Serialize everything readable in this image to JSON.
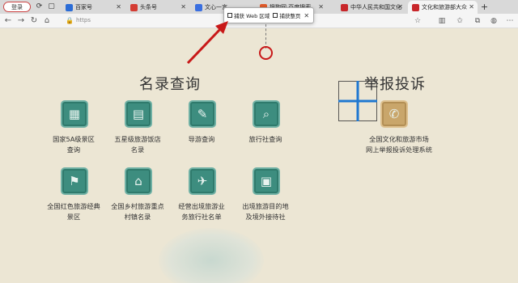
{
  "browser": {
    "login_label": "登录",
    "tabs": [
      {
        "label": "百家号",
        "fav": "#2b6cd6"
      },
      {
        "label": "头条号",
        "fav": "#d43c33"
      },
      {
        "label": "文心一言",
        "fav": "#3a6fe0"
      },
      {
        "label": "搜狗网 百度搜索",
        "fav": "#e05b2b"
      },
      {
        "label": "中华人民共和国文化",
        "fav": "#c8262a"
      },
      {
        "label": "文化和旅游部大众",
        "fav": "#c8262a"
      }
    ],
    "url": "https"
  },
  "capture": {
    "web_area": "捕获 Web 区域",
    "full_page": "捕获整页"
  },
  "sections": {
    "left_title": "名录查询",
    "right_title": "举报投诉"
  },
  "items": [
    {
      "l1": "国家5A级景区",
      "l2": "查询",
      "icon": "scenic-area-icon"
    },
    {
      "l1": "五星级旅游饭店",
      "l2": "名录",
      "icon": "hotel-icon"
    },
    {
      "l1": "导游查询",
      "l2": "",
      "icon": "tour-guide-icon"
    },
    {
      "l1": "旅行社查询",
      "l2": "",
      "icon": "travel-agency-icon"
    },
    {
      "l1": "全国红色旅游经典",
      "l2": "景区",
      "icon": "red-flag-icon"
    },
    {
      "l1": "全国乡村旅游重点",
      "l2": "村镇名录",
      "icon": "village-icon"
    },
    {
      "l1": "经营出境旅游业",
      "l2": "务旅行社名单",
      "icon": "airplane-icon"
    },
    {
      "l1": "出境旅游目的地",
      "l2": "及境外接待社",
      "icon": "destination-icon"
    }
  ],
  "report": {
    "l1": "全国文化和旅游市场",
    "l2": "网上举报投诉处理系统",
    "icon": "phone-icon"
  },
  "colors": {
    "teal": "#3d8d7f",
    "gold": "#c9a66b",
    "annotation_red": "#c81818",
    "grid_blue": "#1f78d1"
  }
}
